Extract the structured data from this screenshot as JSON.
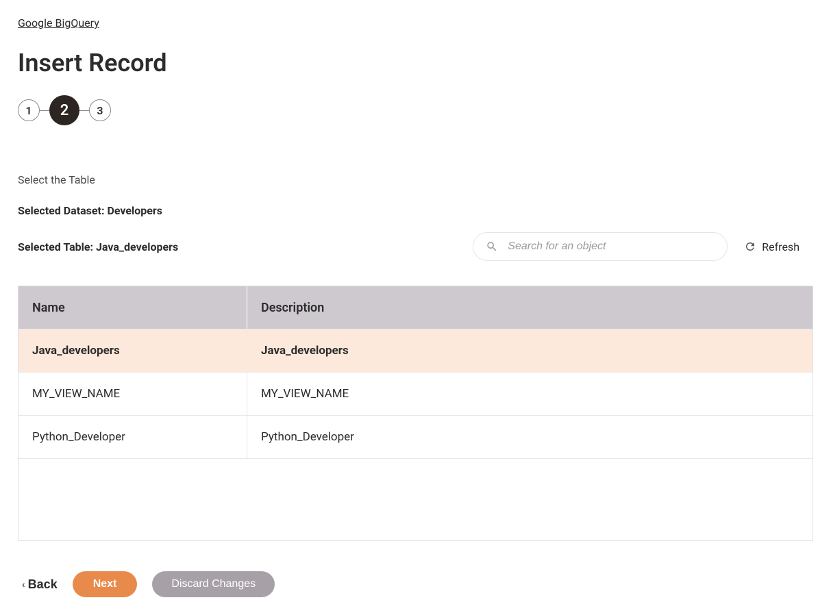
{
  "breadcrumb": {
    "label": "Google BigQuery"
  },
  "page": {
    "title": "Insert Record"
  },
  "stepper": {
    "steps": [
      "1",
      "2",
      "3"
    ],
    "activeIndex": 1
  },
  "section": {
    "label": "Select the Table"
  },
  "selected": {
    "datasetLabel": "Selected Dataset: Developers",
    "tableLabel": "Selected Table: Java_developers"
  },
  "search": {
    "placeholder": "Search for an object"
  },
  "refresh": {
    "label": "Refresh"
  },
  "table": {
    "columns": {
      "name": "Name",
      "description": "Description"
    },
    "rows": [
      {
        "name": "Java_developers",
        "description": "Java_developers",
        "selected": true
      },
      {
        "name": "MY_VIEW_NAME",
        "description": "MY_VIEW_NAME",
        "selected": false
      },
      {
        "name": "Python_Developer",
        "description": "Python_Developer",
        "selected": false
      }
    ]
  },
  "actions": {
    "back": "Back",
    "next": "Next",
    "discard": "Discard Changes"
  }
}
